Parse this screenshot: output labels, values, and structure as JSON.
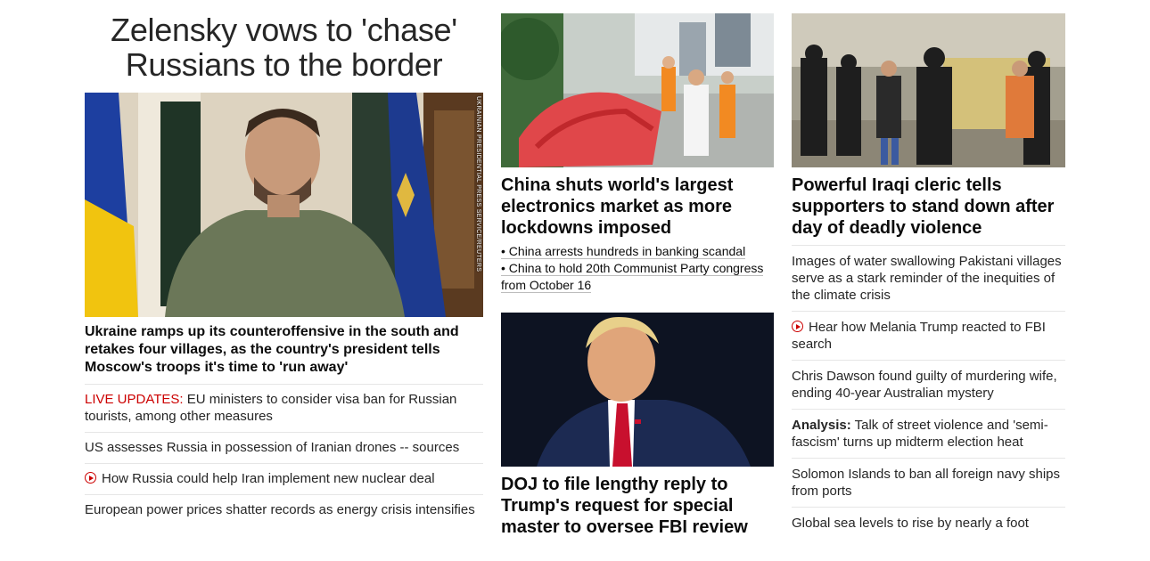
{
  "lead": {
    "title": "Zelensky vows to 'chase' Russians to the border",
    "photo_credit": "UKRAINIAN PRESIDENTIAL PRESS SERVICE/REUTERS",
    "headline": "Ukraine ramps up its counteroffensive in the south and retakes four villages, as the country's president tells Moscow's troops it's time to 'run away'",
    "links": [
      {
        "prefix": "LIVE UPDATES:",
        "text": "EU ministers to consider visa ban for Russian tourists, among other measures"
      },
      {
        "text": "US assesses Russia in possession of Iranian drones -- sources"
      },
      {
        "video": true,
        "text": "How Russia could help Iran implement new nuclear deal"
      },
      {
        "text": "European power prices shatter records as energy crisis intensifies"
      }
    ]
  },
  "china": {
    "headline": "China shuts world's largest electronics market as more lockdowns imposed",
    "sub_links": [
      "• China arrests hundreds in banking scandal",
      "• China to hold 20th Communist Party congress",
      "from October 16"
    ]
  },
  "doj": {
    "headline": "DOJ to file lengthy reply to Trump's request for special master to oversee FBI review"
  },
  "iraq": {
    "headline": "Powerful Iraqi cleric tells supporters to stand down after day of deadly violence",
    "links": [
      {
        "text": "Images of water swallowing Pakistani villages serve as a stark reminder of the inequities of the climate crisis"
      },
      {
        "video": true,
        "text": "Hear how Melania Trump reacted to FBI search"
      },
      {
        "text": "Chris Dawson found guilty of murdering wife, ending 40-year Australian mystery"
      },
      {
        "prefix": "Analysis:",
        "text": "Talk of street violence and 'semi-fascism' turns up midterm election heat"
      },
      {
        "text": "Solomon Islands to ban all foreign navy ships from ports"
      },
      {
        "text": "Global sea levels to rise by nearly a foot"
      }
    ]
  },
  "colors": {
    "accent_red": "#cc0000",
    "text": "#0c0c0c",
    "divider": "#e6e6e6"
  }
}
